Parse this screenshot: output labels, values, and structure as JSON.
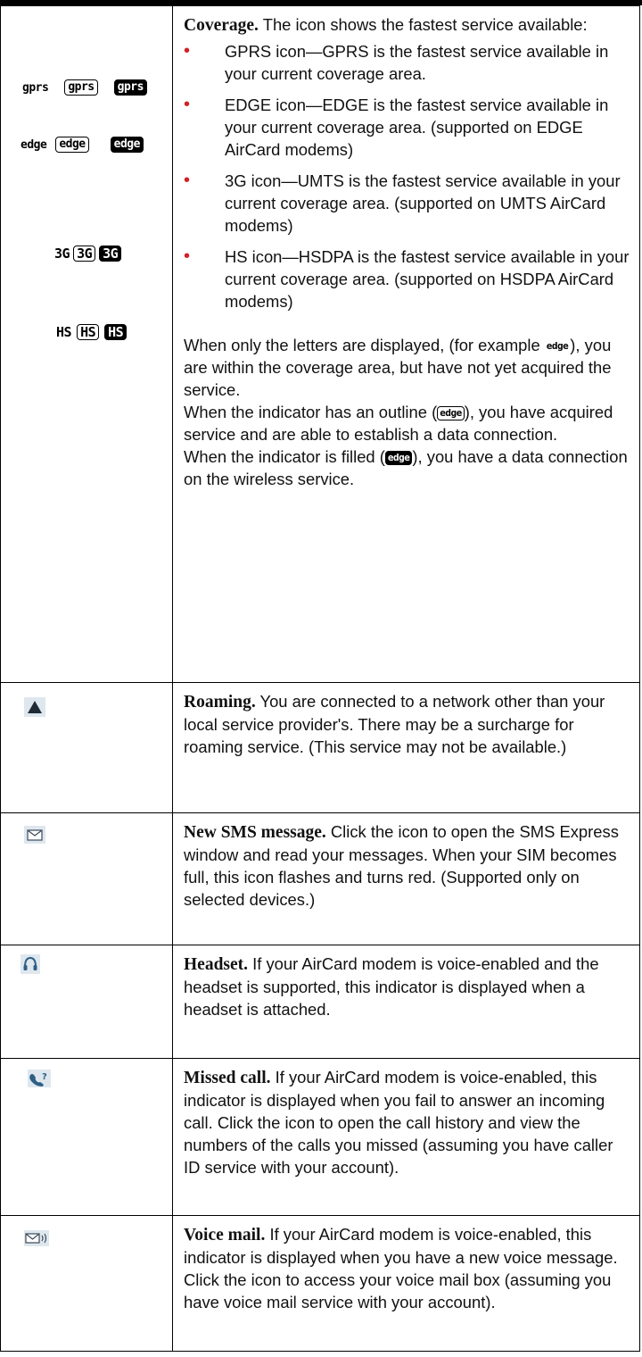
{
  "coverage": {
    "heading": "Coverage.",
    "intro": " The icon shows the fastest service available:",
    "icon_rows": [
      {
        "plain": "gprs",
        "outline": "gprs",
        "filled": "gprs"
      },
      {
        "plain": "edge",
        "outline": "edge",
        "filled": "edge"
      },
      {
        "plain": "3G",
        "outline": "3G",
        "filled": "3G"
      },
      {
        "plain": "HS",
        "outline": "HS",
        "filled": "HS"
      }
    ],
    "bullets": [
      "GPRS icon—GPRS is the fastest service available in your current coverage area.",
      "EDGE icon—EDGE is the fastest service available in your current coverage area. (supported on EDGE AirCard modems)",
      "3G icon—UMTS is the fastest service available in your current coverage area. (supported on UMTS AirCard modems)",
      "HS icon—HSDPA is the fastest service available in your current coverage area. (supported on HSDPA AirCard modems)"
    ],
    "para1_a": "When only the letters are displayed, (for example ",
    "para1_icon": "edge",
    "para1_b": "), you are within the coverage area, but have not yet acquired the service.",
    "para2_a": "When the indicator has an outline (",
    "para2_icon": "edge",
    "para2_b": "), you have acquired service and are able to establish a data connection.",
    "para3_a": "When the indicator is filled (",
    "para3_icon": "edge",
    "para3_b": "), you have a data connection on the wireless service."
  },
  "rows": [
    {
      "icon": "roaming-triangle-icon",
      "heading": "Roaming.",
      "text": " You are connected to a network other than your local service provider's. There may be a surcharge for roaming service. (This service may not be available.)"
    },
    {
      "icon": "envelope-icon",
      "heading": "New SMS message.",
      "text": " Click the icon to open the SMS Express window and read your messages. When your SIM becomes full, this icon flashes and turns red. (Supported only on selected devices.)"
    },
    {
      "icon": "headset-icon",
      "heading": "Headset.",
      "text": " If your AirCard modem is voice-enabled and the headset is supported, this indicator is displayed when a headset is attached."
    },
    {
      "icon": "missed-call-icon",
      "heading": "Missed call.",
      "text": " If your AirCard modem is voice-enabled, this indicator is displayed when you fail to answer an incoming call. Click the icon to open the call history and view the numbers of the calls you missed (assuming you have caller ID service with your account)."
    },
    {
      "icon": "voice-mail-icon",
      "heading": "Voice mail.",
      "text": " If your AirCard modem is voice-enabled, this indicator is displayed when you have a new voice message. Click the icon to access your voice mail box (assuming you have voice mail service with your account)."
    }
  ]
}
